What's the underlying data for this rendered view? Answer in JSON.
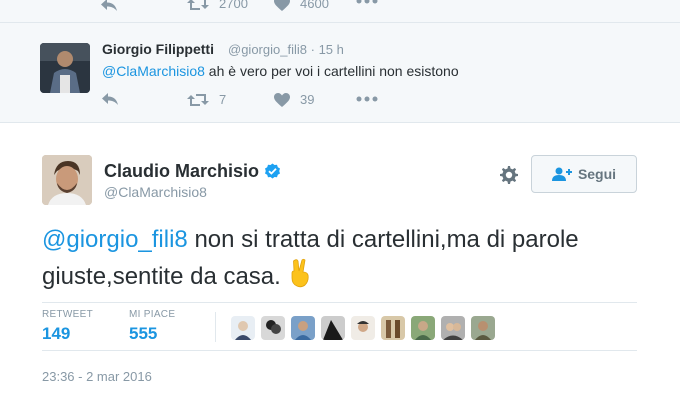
{
  "top_tweet": {
    "retweet_count": "2700",
    "like_count": "4600"
  },
  "reply": {
    "name": "Giorgio Filippetti",
    "handle": "@giorgio_fili8",
    "separator": "·",
    "time": "15 h",
    "mention": "@ClaMarchisio8",
    "text": " ah è vero per voi i cartellini non esistono",
    "retweet_count": "7",
    "like_count": "39"
  },
  "main": {
    "name": "Claudio Marchisio",
    "handle": "@ClaMarchisio8",
    "follow_label": "Segui",
    "mention": "@giorgio_fili8",
    "text": " non si tratta di cartellini,ma di parole giuste,sentite da casa.",
    "retweet_label": "RETWEET",
    "retweet_count": "149",
    "likes_label": "MI PIACE",
    "likes_count": "555",
    "timestamp": "23:36 - 2 mar 2016"
  },
  "colors": {
    "link": "#1b95e0",
    "muted": "#8899a6",
    "text": "#292f33"
  },
  "icons": [
    "reply-icon",
    "retweet-icon",
    "heart-icon",
    "more-icon",
    "verified-icon",
    "gear-icon",
    "follow-person-icon",
    "victory-hand-emoji"
  ]
}
